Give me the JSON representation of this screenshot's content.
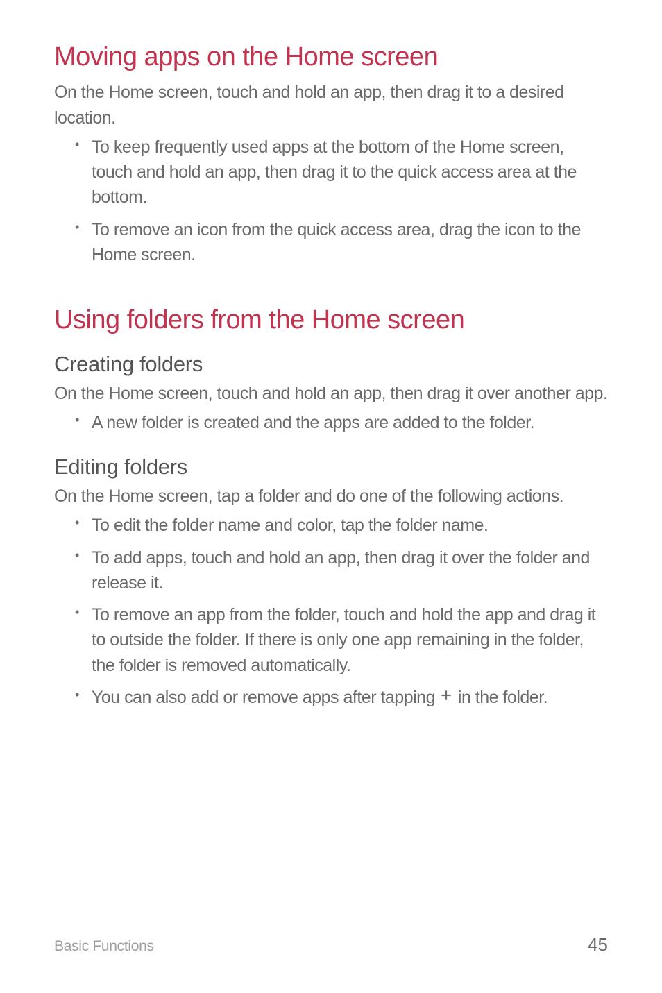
{
  "section1": {
    "heading": "Moving apps on the Home screen",
    "intro": "On the Home screen, touch and hold an app, then drag it to a desired location.",
    "bullets": [
      "To keep frequently used apps at the bottom of the Home screen, touch and hold an app, then drag it to the quick access area at the bottom.",
      "To remove an icon from the quick access area, drag the icon to the Home screen."
    ]
  },
  "section2": {
    "heading": "Using folders from the Home screen",
    "sub1": {
      "heading": "Creating folders",
      "intro": "On the Home screen, touch and hold an app, then drag it over another app.",
      "bullets": [
        "A new folder is created and the apps are added to the folder."
      ]
    },
    "sub2": {
      "heading": "Editing folders",
      "intro": "On the Home screen, tap a folder and do one of the following actions.",
      "bullets": [
        "To edit the folder name and color, tap the folder name.",
        "To add apps, touch and hold an app, then drag it over the folder and release it.",
        "To remove an app from the folder, touch and hold the app and drag it to outside the folder. If there is only one app remaining in the folder, the folder is removed automatically."
      ],
      "bullet4_pre": "You can also add or remove apps after tapping ",
      "bullet4_post": " in the folder."
    }
  },
  "footer": {
    "section_name": "Basic Functions",
    "page_number": "45"
  }
}
